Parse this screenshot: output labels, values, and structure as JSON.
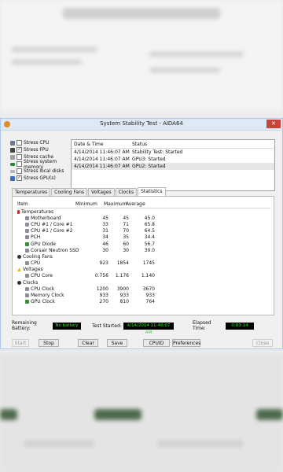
{
  "window": {
    "title": "System Stability Test - AIDA64",
    "close_glyph": "✕"
  },
  "stress": [
    {
      "label": "Stress CPU",
      "checked": false,
      "icon": "cpu-icon"
    },
    {
      "label": "Stress FPU",
      "checked": true,
      "icon": "fpu-icon"
    },
    {
      "label": "Stress cache",
      "checked": false,
      "icon": "cache-icon"
    },
    {
      "label": "Stress system memory",
      "checked": false,
      "icon": "memory-icon"
    },
    {
      "label": "Stress local disks",
      "checked": false,
      "icon": "disk-icon"
    },
    {
      "label": "Stress GPU(s)",
      "checked": true,
      "icon": "gpu-icon"
    }
  ],
  "log": {
    "headers": [
      "Date & Time",
      "Status"
    ],
    "rows": [
      {
        "time": "4/14/2014 11:46:07 AM",
        "status": "Stability Test: Started"
      },
      {
        "time": "4/14/2014 11:46:07 AM",
        "status": "GPU3: Started"
      },
      {
        "time": "4/14/2014 11:46:07 AM",
        "status": "GPU2: Started"
      }
    ]
  },
  "tabs": [
    "Temperatures",
    "Cooling Fans",
    "Voltages",
    "Clocks",
    "Statistics"
  ],
  "active_tab": "Statistics",
  "stats": {
    "headers": [
      "Item",
      "Minimum",
      "Maximum",
      "Average"
    ],
    "groups": [
      {
        "name": "Temperatures",
        "icon": "thermometer-icon",
        "items": [
          {
            "name": "Motherboard",
            "min": "45",
            "max": "45",
            "avg": "45.0",
            "icon": "motherboard-icon"
          },
          {
            "name": "CPU #1 / Core #1",
            "min": "33",
            "max": "71",
            "avg": "65.8",
            "icon": "cpu-core-icon"
          },
          {
            "name": "CPU #1 / Core #2",
            "min": "31",
            "max": "70",
            "avg": "64.5",
            "icon": "cpu-core-icon"
          },
          {
            "name": "PCH",
            "min": "34",
            "max": "35",
            "avg": "34.4",
            "icon": "pch-icon"
          },
          {
            "name": "GPU Diode",
            "min": "46",
            "max": "60",
            "avg": "56.7",
            "icon": "gpu-diode-icon"
          },
          {
            "name": "Corsair Neutron SSD",
            "min": "30",
            "max": "30",
            "avg": "30.0",
            "icon": "ssd-icon"
          }
        ]
      },
      {
        "name": "Cooling Fans",
        "icon": "fan-icon",
        "items": [
          {
            "name": "CPU",
            "min": "923",
            "max": "1854",
            "avg": "1745",
            "icon": "cpu-icon"
          }
        ]
      },
      {
        "name": "Voltages",
        "icon": "voltage-icon",
        "items": [
          {
            "name": "CPU Core",
            "min": "0.756",
            "max": "1.176",
            "avg": "1.140",
            "icon": "cpu-icon"
          }
        ]
      },
      {
        "name": "Clocks",
        "icon": "clock-icon",
        "items": [
          {
            "name": "CPU Clock",
            "min": "1200",
            "max": "3900",
            "avg": "3670",
            "icon": "cpu-icon"
          },
          {
            "name": "Memory Clock",
            "min": "933",
            "max": "933",
            "avg": "933",
            "icon": "memory-icon"
          },
          {
            "name": "GPU Clock",
            "min": "270",
            "max": "810",
            "avg": "764",
            "icon": "gpu-icon"
          }
        ]
      }
    ]
  },
  "status": {
    "battery_label": "Remaining Battery:",
    "battery_value": "No battery",
    "started_label": "Test Started:",
    "started_value": "4/14/2014 11:46:07 AM",
    "elapsed_label": "Elapsed Time:",
    "elapsed_value": "0:03:14"
  },
  "buttons": {
    "start": "Start",
    "stop": "Stop",
    "clear": "Clear",
    "save": "Save",
    "cpuid": "CPUID",
    "preferences": "Preferences",
    "close": "Close"
  },
  "colors": {
    "lcd_text": "#2ee12e",
    "lcd_bg": "#000000",
    "title_bar": "#dfe9f5"
  }
}
